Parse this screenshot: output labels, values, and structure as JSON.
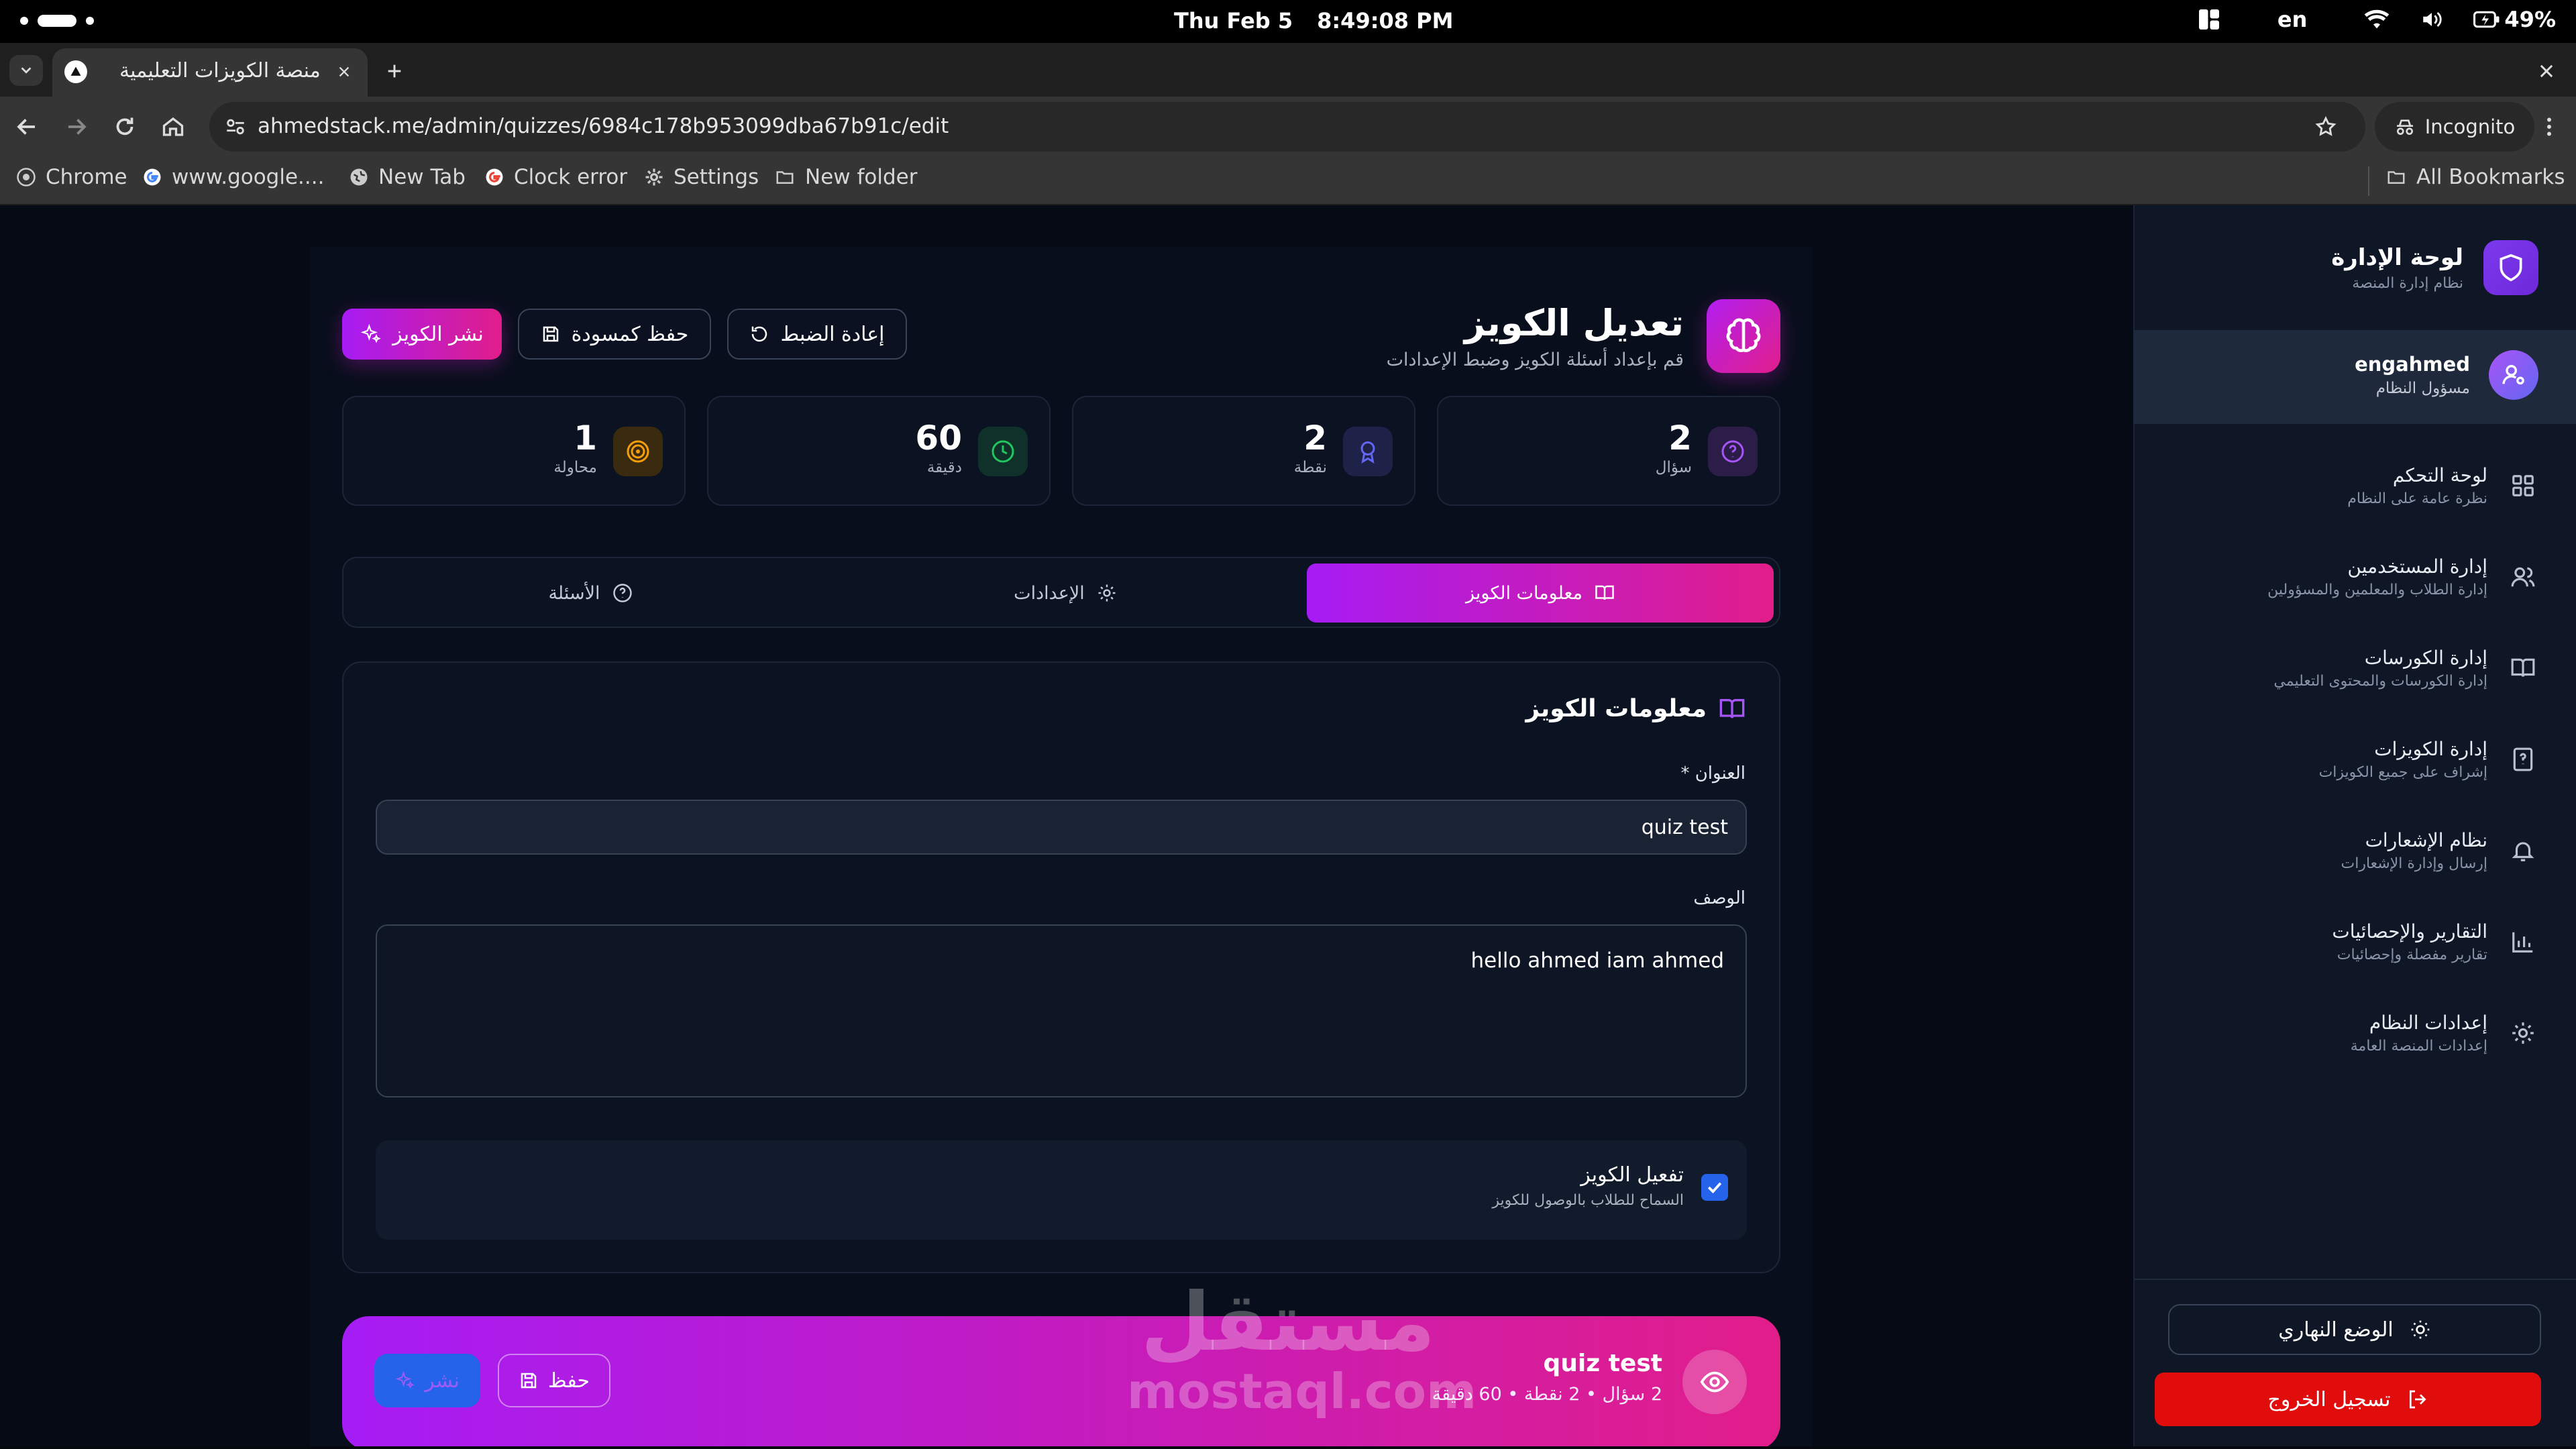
{
  "os_menubar": {
    "date": "Thu Feb 5",
    "time": "8:49:08 PM",
    "lang": "en",
    "battery": "49%"
  },
  "browser": {
    "tab_title": "منصة الكويزات التعليمية",
    "url": "ahmedstack.me/admin/quizzes/6984c178b953099dba67b91c/edit",
    "incognito_label": "Incognito",
    "bookmarks": [
      "Chrome",
      "www.google....",
      "New Tab",
      "Clock error",
      "Settings",
      "New folder"
    ],
    "all_bookmarks": "All Bookmarks"
  },
  "sidebar": {
    "brand_title": "لوحة الإدارة",
    "brand_sub": "نظام إدارة المنصة",
    "user_name": "engahmed",
    "user_role": "مسؤول النظام",
    "items": [
      {
        "title": "لوحة التحكم",
        "sub": "نظرة عامة على النظام",
        "icon": "grid-icon"
      },
      {
        "title": "إدارة المستخدمين",
        "sub": "إدارة الطلاب والمعلمين والمسؤولين",
        "icon": "users-icon"
      },
      {
        "title": "إدارة الكورسات",
        "sub": "إدارة الكورسات والمحتوى التعليمي",
        "icon": "book-icon"
      },
      {
        "title": "إدارة الكويزات",
        "sub": "إشراف على جميع الكويزات",
        "icon": "quiz-file-icon"
      },
      {
        "title": "نظام الإشعارات",
        "sub": "إرسال وإدارة الإشعارات",
        "icon": "bell-icon"
      },
      {
        "title": "التقارير والإحصائيات",
        "sub": "تقارير مفصلة وإحصائيات",
        "icon": "bar-chart-icon"
      },
      {
        "title": "إعدادات النظام",
        "sub": "إعدادات المنصة العامة",
        "icon": "gear-icon"
      }
    ],
    "day_mode": "الوضع النهاري",
    "logout": "تسجيل الخروج"
  },
  "header": {
    "title": "تعديل الكويز",
    "subtitle": "قم بإعداد أسئلة الكويز وضبط الإعدادات",
    "reset_label": "إعادة الضبط",
    "draft_label": "حفظ كمسودة",
    "publish_label": "نشر الكويز"
  },
  "stats": [
    {
      "value": "2",
      "label": "سؤال",
      "icon": "question-circle-icon",
      "color": "#a855f7"
    },
    {
      "value": "2",
      "label": "نقطة",
      "icon": "award-icon",
      "color": "#6366f1"
    },
    {
      "value": "60",
      "label": "دقيقة",
      "icon": "clock-icon",
      "color": "#22c55e"
    },
    {
      "value": "1",
      "label": "محاولة",
      "icon": "target-icon",
      "color": "#f59e0b"
    }
  ],
  "tabs": [
    {
      "label": "معلومات الكويز",
      "icon": "book-icon",
      "active": true
    },
    {
      "label": "الإعدادات",
      "icon": "gear-icon",
      "active": false
    },
    {
      "label": "الأسئلة",
      "icon": "question-circle-icon",
      "active": false
    }
  ],
  "form": {
    "section_title": "معلومات الكويز",
    "title_label": "العنوان *",
    "title_value": "quiz test",
    "desc_label": "الوصف",
    "desc_value": "hello ahmed iam ahmed",
    "activate_label": "تفعيل الكويز",
    "activate_sub": "السماح للطلاب بالوصول للكويز",
    "activate_checked": true
  },
  "bottom_bar": {
    "quiz_name": "quiz test",
    "meta": "2 سؤال • 2 نقطة • 60 دقيقة",
    "save_label": "حفظ",
    "publish_label": "نشر"
  },
  "watermark": {
    "arabic": "مستقل",
    "latin": "mostaql.com"
  }
}
